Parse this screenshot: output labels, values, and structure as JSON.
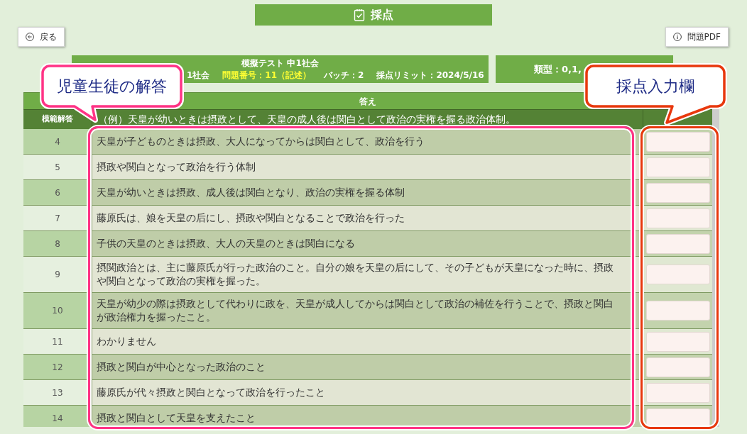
{
  "header": {
    "title": "採点"
  },
  "buttons": {
    "back": "戻る",
    "pdf": "問題PDF"
  },
  "info": {
    "test_name": "模擬テスト 中1社会",
    "items": [
      {
        "text": "1社会",
        "highlight": false
      },
      {
        "text": "問題番号：11（記述）",
        "highlight": true
      },
      {
        "text": "バッチ：2",
        "highlight": false
      },
      {
        "text": "採点リミット：2024/5/16",
        "highlight": false
      }
    ]
  },
  "type_box": {
    "text": "類型：0,1,"
  },
  "table": {
    "header": "答え",
    "model_answer_label": "模範解答",
    "model_answer": "（例）天皇が幼いときは摂政として、天皇の成人後は関白として政治の実権を握る政治体制。",
    "rows": [
      {
        "number": "4",
        "answer": "天皇が子どものときは摂政、大人になってからは関白として、政治を行う"
      },
      {
        "number": "5",
        "answer": "摂政や関白となって政治を行う体制"
      },
      {
        "number": "6",
        "answer": "天皇が幼いときは摂政、成人後は関白となり、政治の実権を握る体制"
      },
      {
        "number": "7",
        "answer": "藤原氏は、娘を天皇の后にし、摂政や関白となることで政治を行った"
      },
      {
        "number": "8",
        "answer": "子供の天皇のときは摂政、大人の天皇のときは関白になる"
      },
      {
        "number": "9",
        "answer": "摂関政治とは、主に藤原氏が行った政治のこと。自分の娘を天皇の后にして、その子どもが天皇になった時に、摂政や関白となって政治の実権を握った。"
      },
      {
        "number": "10",
        "answer": "天皇が幼少の際は摂政として代わりに政を、天皇が成人してからは関白として政治の補佐を行うことで、摂政と関白が政治権力を握ったこと。"
      },
      {
        "number": "11",
        "answer": "わかりません"
      },
      {
        "number": "12",
        "answer": "摂政と関白が中心となった政治のこと"
      },
      {
        "number": "13",
        "answer": "藤原氏が代々摂政と関白となって政治を行ったこと"
      },
      {
        "number": "14",
        "answer": "摂政と関白として天皇を支えたこと"
      }
    ]
  },
  "callouts": [
    {
      "text": "児童生徒の解答",
      "color": "#ff3385"
    },
    {
      "text": "採点入力欄",
      "color": "#e8380d"
    }
  ]
}
